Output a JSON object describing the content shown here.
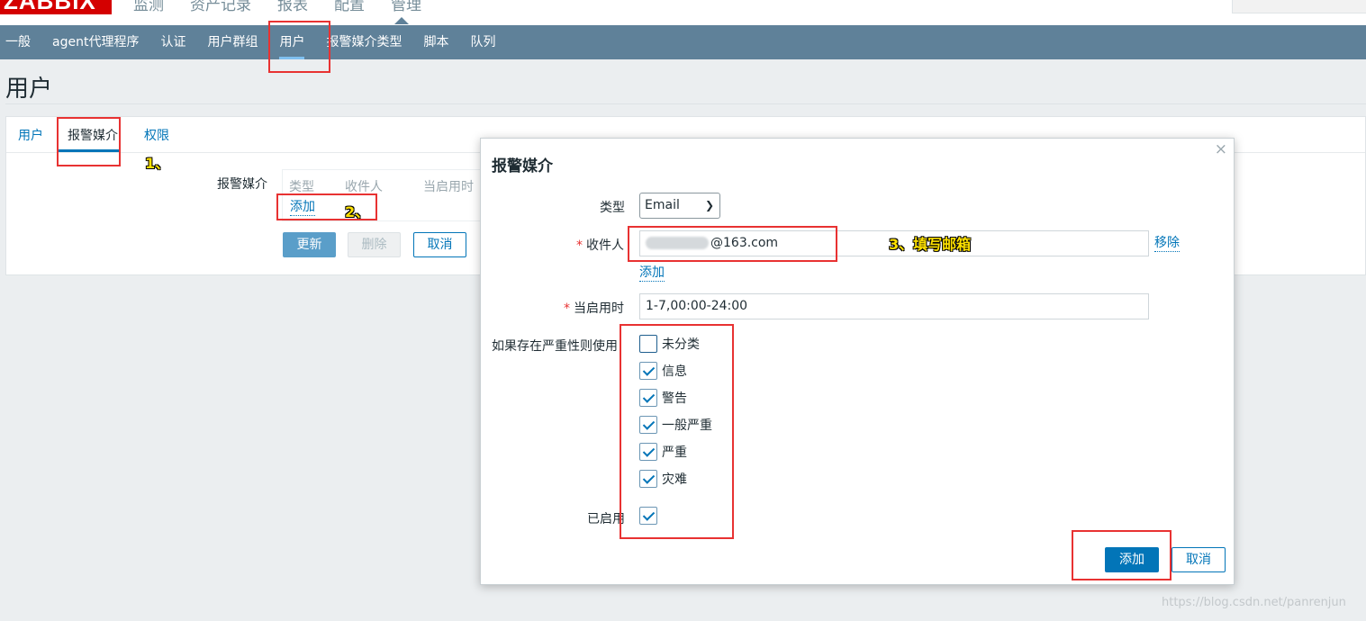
{
  "header": {
    "logo_text": "ZABBIX",
    "menu": [
      "监测",
      "资产记录",
      "报表",
      "配置",
      "管理"
    ]
  },
  "subnav": {
    "items": [
      "一般",
      "agent代理程序",
      "认证",
      "用户群组",
      "用户",
      "报警媒介类型",
      "脚本",
      "队列"
    ],
    "active_index": 4
  },
  "page": {
    "title": "用户"
  },
  "tabs": [
    "用户",
    "报警媒介",
    "权限"
  ],
  "media_section": {
    "label": "报警媒介",
    "columns": [
      "类型",
      "收件人",
      "当启用时"
    ],
    "add_link": "添加"
  },
  "form_buttons": {
    "update": "更新",
    "delete": "删除",
    "cancel": "取消"
  },
  "annotations": {
    "step1": "1、",
    "step2": "2、",
    "step3": "3、填写邮箱"
  },
  "dialog": {
    "title": "报警媒介",
    "close": "×",
    "type_label": "类型",
    "type_value": "Email",
    "recipient_label": "收件人",
    "recipient_value": "@163.com",
    "remove_link": "移除",
    "add_link": "添加",
    "when_active_label": "当启用时",
    "when_active_value": "1-7,00:00-24:00",
    "severity_label": "如果存在严重性则使用",
    "severities": [
      {
        "label": "未分类",
        "checked": false
      },
      {
        "label": "信息",
        "checked": true
      },
      {
        "label": "警告",
        "checked": true
      },
      {
        "label": "一般严重",
        "checked": true
      },
      {
        "label": "严重",
        "checked": true
      },
      {
        "label": "灾难",
        "checked": true
      }
    ],
    "enabled_label": "已启用",
    "enabled_checked": true,
    "add_button": "添加",
    "cancel_button": "取消"
  },
  "watermark": "https://blog.csdn.net/panrenjun",
  "colors": {
    "nav_bg": "#5f8199",
    "accent": "#0275b8",
    "annotation": "#e83232",
    "logo": "#d40000"
  }
}
